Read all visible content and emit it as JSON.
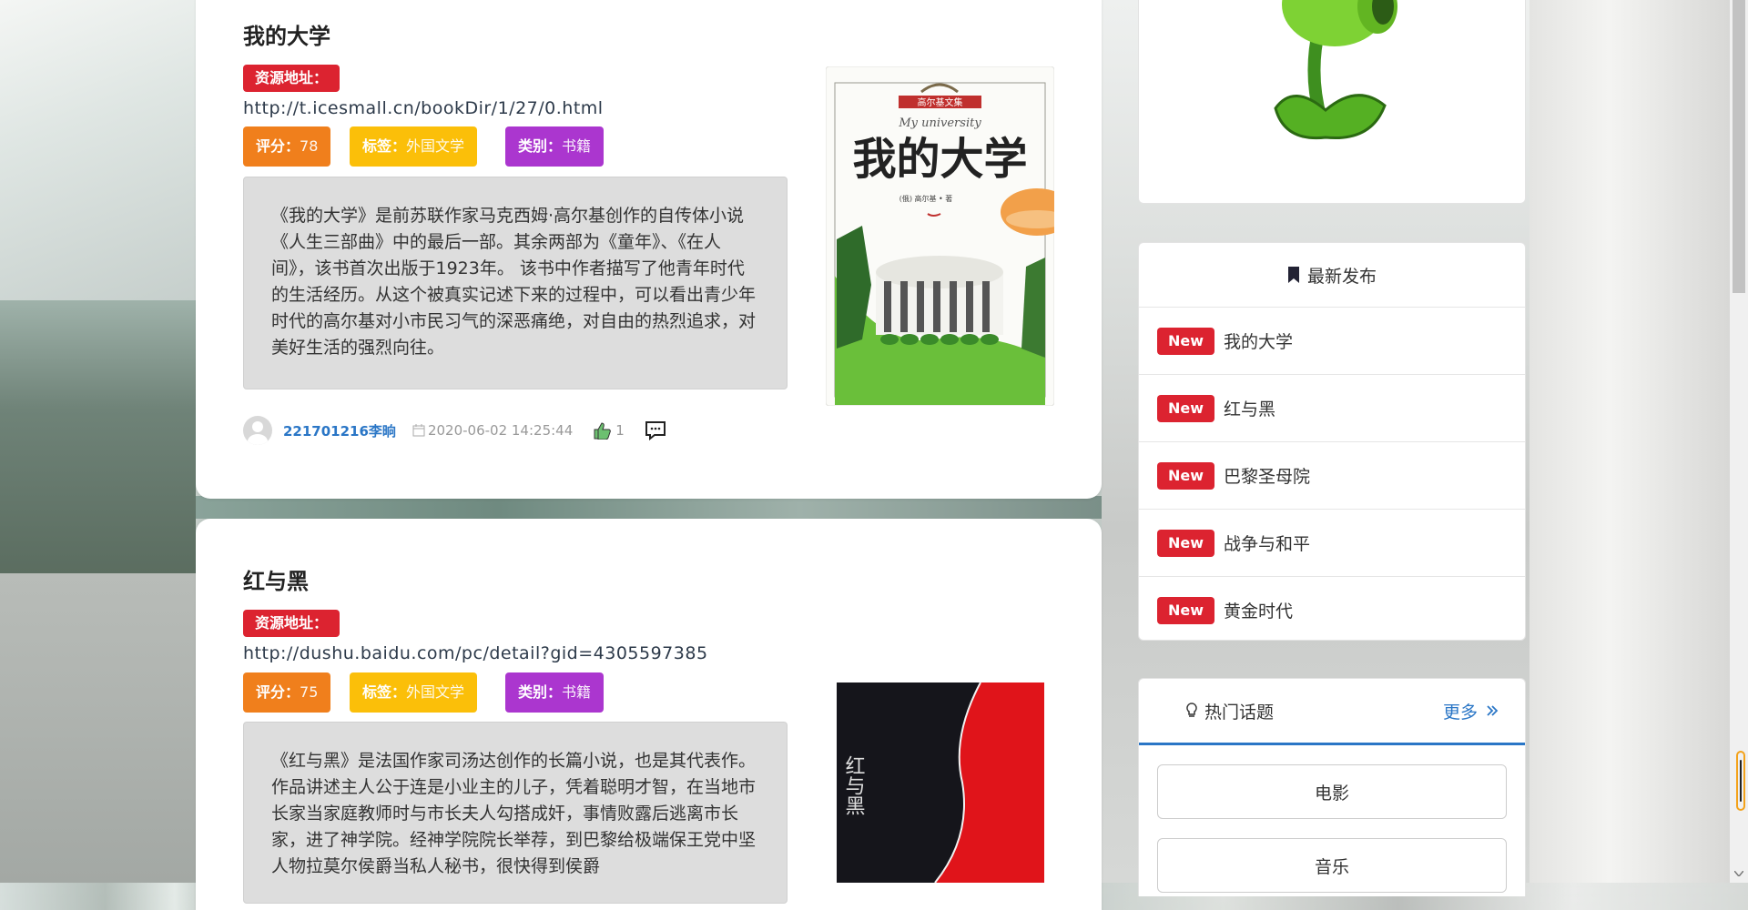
{
  "posts": [
    {
      "title": "我的大学",
      "resource_label": "资源地址：",
      "url": "http://t.icesmall.cn/bookDir/1/27/0.html",
      "score_label": "评分：",
      "score": "78",
      "tag_label": "标签：",
      "tag": "外国文学",
      "category_label": "类别：",
      "category": "书籍",
      "description": "《我的大学》是前苏联作家马克西姆·高尔基创作的自传体小说《人生三部曲》中的最后一部。其余两部为《童年》、《在人间》，该书首次出版于1923年。 该书中作者描写了他青年时代的生活经历。从这个被真实记述下来的过程中，可以看出青少年时代的高尔基对小市民习气的深恶痛绝，对自由的热烈追求，对美好生活的强烈向往。",
      "cover": {
        "series": "高尔基文集",
        "subtitle": "My university",
        "title": "我的大学",
        "author": "(俄) 高尔基 • 著"
      },
      "author": "221701216李晌",
      "date": "2020-06-02 14:25:44",
      "likes": "1"
    },
    {
      "title": "红与黑",
      "resource_label": "资源地址：",
      "url": "http://dushu.baidu.com/pc/detail?gid=4305597385",
      "score_label": "评分：",
      "score": "75",
      "tag_label": "标签：",
      "tag": "外国文学",
      "category_label": "类别：",
      "category": "书籍",
      "description": "《红与黑》是法国作家司汤达创作的长篇小说，也是其代表作。作品讲述主人公于连是小业主的儿子，凭着聪明才智，在当地市长家当家庭教师时与市长夫人勾搭成奸，事情败露后逃离市长家，进了神学院。经神学院院长举荐，到巴黎给极端保王党中坚人物拉莫尔侯爵当私人秘书，很快得到侯爵",
      "cover": {
        "title": "红与黑"
      }
    }
  ],
  "sidebar": {
    "latest": {
      "title": "最新发布",
      "badge": "New",
      "items": [
        "我的大学",
        "红与黑",
        "巴黎圣母院",
        "战争与和平",
        "黄金时代"
      ]
    },
    "hot": {
      "title": "热门话题",
      "more": "更多",
      "topics": [
        "电影",
        "音乐"
      ]
    }
  },
  "colors": {
    "badge_red": "#dc2330",
    "score_orange": "#f07f1c",
    "tag_yellow": "#fbbf09",
    "category_purple": "#ab36cf",
    "link_blue": "#2a76c6"
  }
}
